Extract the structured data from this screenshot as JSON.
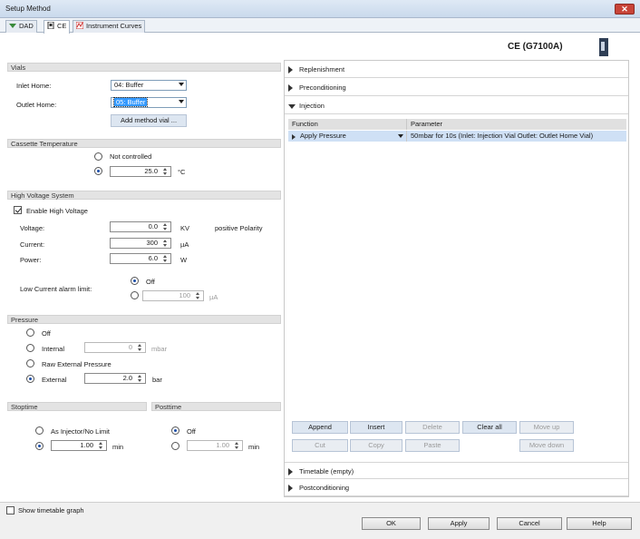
{
  "window": {
    "title": "Setup Method",
    "close": "✕"
  },
  "tabs": [
    {
      "label": "DAD"
    },
    {
      "label": "CE"
    },
    {
      "label": "Instrument Curves"
    }
  ],
  "module": {
    "name": "CE (G7100A)"
  },
  "vials": {
    "header": "Vials",
    "inlet_label": "Inlet Home:",
    "inlet_value": "04: Buffer",
    "outlet_label": "Outlet Home:",
    "outlet_value": "05: Buffer",
    "add_button": "Add method vial ..."
  },
  "cassette": {
    "header": "Cassette Temperature",
    "not_controlled": "Not controlled",
    "value": "25.0",
    "unit": "°C"
  },
  "hv": {
    "header": "High Voltage System",
    "enable_label": "Enable High Voltage",
    "voltage_label": "Voltage:",
    "voltage_value": "0.0",
    "voltage_unit": "KV",
    "polarity": "positive Polarity",
    "current_label": "Current:",
    "current_value": "300",
    "current_unit": "µA",
    "power_label": "Power:",
    "power_value": "6.0",
    "power_unit": "W",
    "low_alarm_label": "Low Current alarm limit:",
    "off_label": "Off",
    "alarm_value": "100",
    "alarm_unit": "µA"
  },
  "pressure": {
    "header": "Pressure",
    "off": "Off",
    "internal": "Internal",
    "internal_value": "0",
    "internal_unit": "mbar",
    "raw_external": "Raw External Pressure",
    "external": "External",
    "external_value": "2.0",
    "external_unit": "bar"
  },
  "stoptime": {
    "header": "Stoptime",
    "as_injector": "As Injector/No Limit",
    "value": "1.00",
    "unit": "min"
  },
  "posttime": {
    "header": "Posttime",
    "off": "Off",
    "value": "1.00",
    "unit": "min"
  },
  "accordion": {
    "replenishment": "Replenishment",
    "preconditioning": "Preconditioning",
    "injection": "Injection",
    "timetable": "Timetable (empty)",
    "postconditioning": "Postconditioning"
  },
  "injection_table": {
    "col_function": "Function",
    "col_parameter": "Parameter",
    "row_function": "Apply Pressure",
    "row_parameter": "50mbar for 10s (Inlet: Injection Vial Outlet: Outlet Home Vial)"
  },
  "table_buttons": {
    "append": "Append",
    "insert": "Insert",
    "delete": "Delete",
    "clear_all": "Clear all",
    "move_up": "Move up",
    "cut": "Cut",
    "copy": "Copy",
    "paste": "Paste",
    "move_down": "Move down"
  },
  "footer": {
    "show_timetable": "Show timetable graph",
    "ok": "OK",
    "apply": "Apply",
    "cancel": "Cancel",
    "help": "Help"
  },
  "colors": {
    "selection": "#3399ff",
    "row_highlight": "#cfe0f5",
    "header_gray": "#e3e3e3"
  }
}
